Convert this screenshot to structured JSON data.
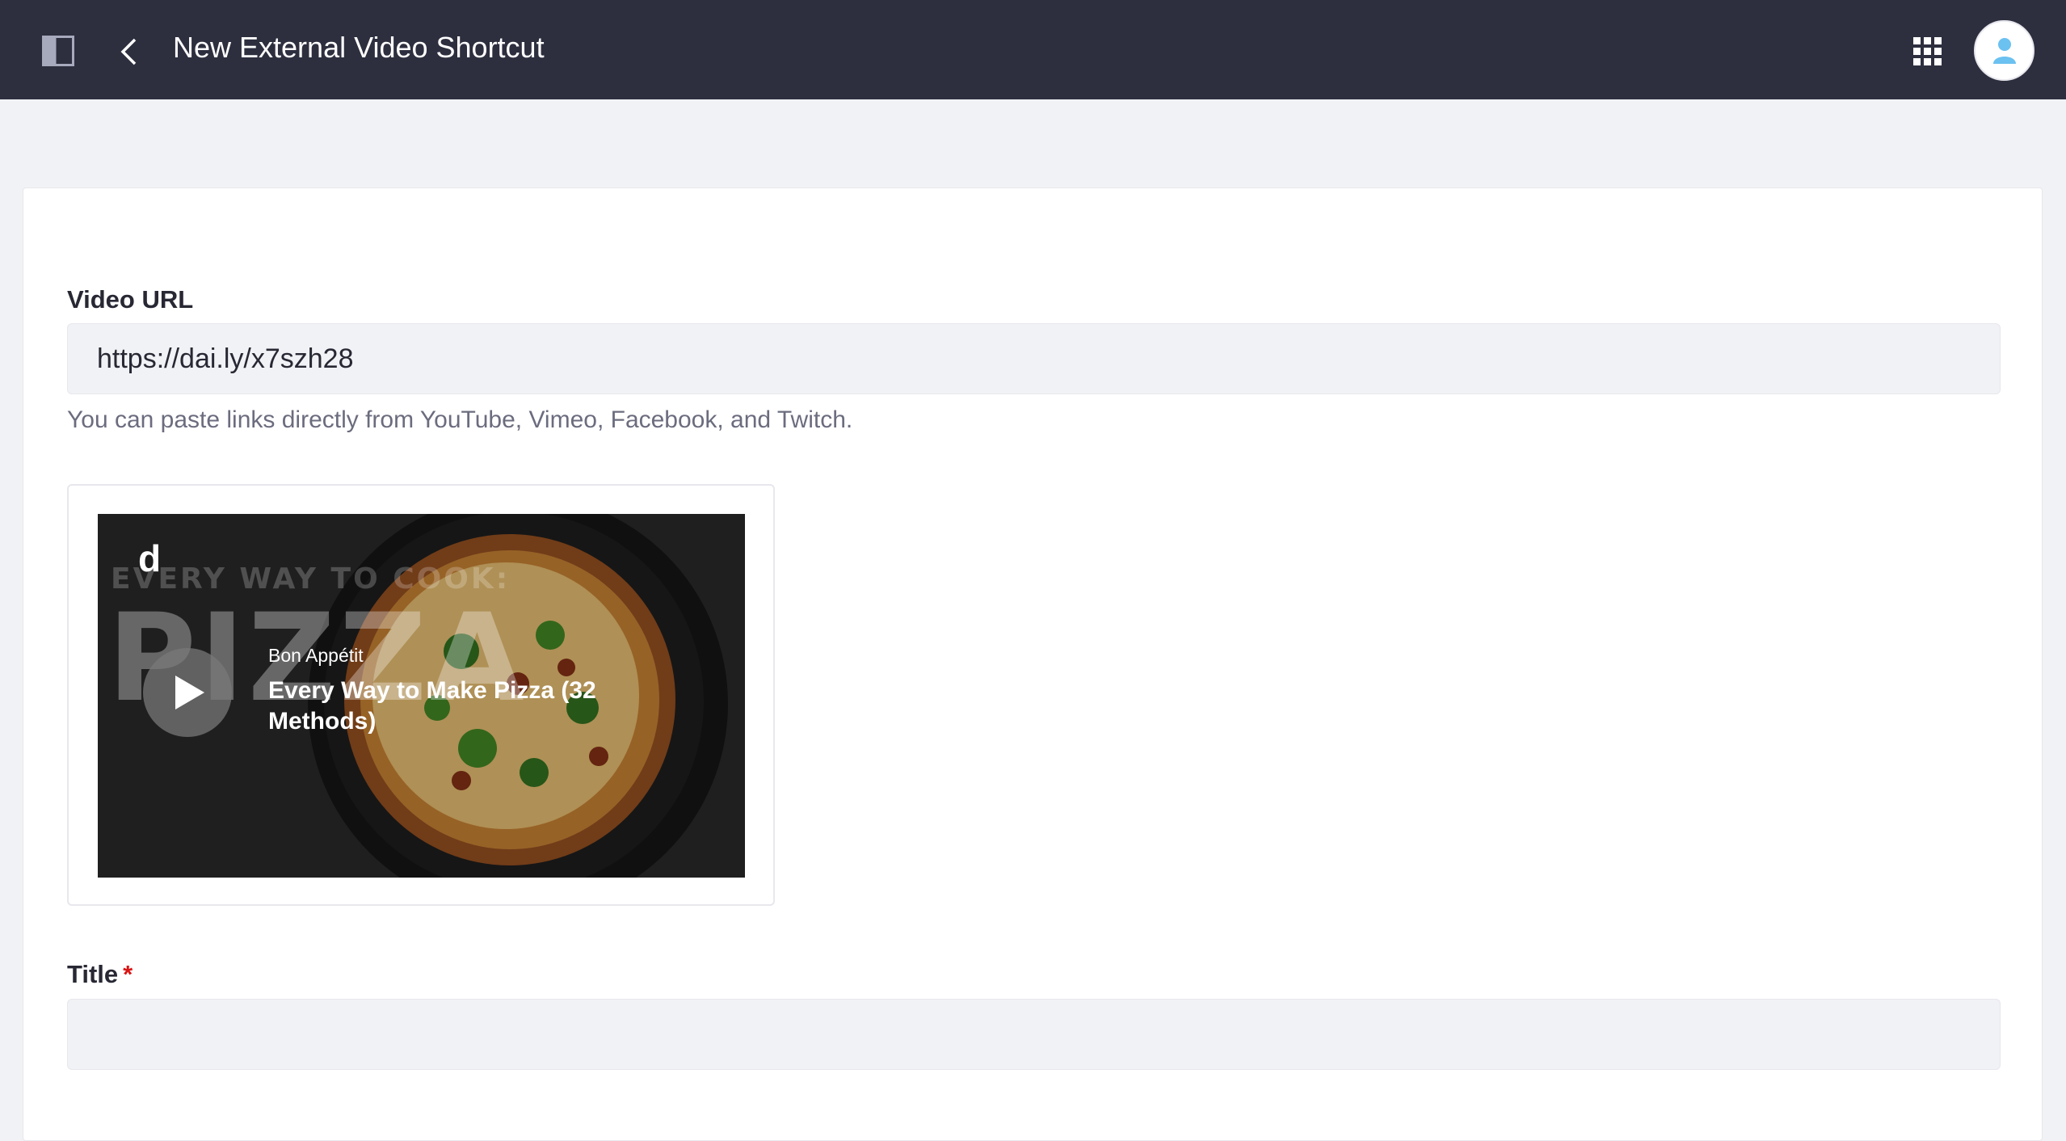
{
  "header": {
    "title": "New External Video Shortcut"
  },
  "form": {
    "video_url_label": "Video URL",
    "video_url_value": "https://dai.ly/x7szh28",
    "help_text": "You can paste links directly from YouTube, Vimeo, Facebook, and Twitch.",
    "title_label": "Title",
    "title_required_marker": "*",
    "title_value": ""
  },
  "preview": {
    "provider_logo": "d",
    "overlay_line_1": "EVERY WAY TO COOK:",
    "overlay_line_2": "PIZZA",
    "channel": "Bon Appétit",
    "video_title": "Every Way to Make Pizza (32 Methods)"
  },
  "colors": {
    "topbar": "#2d2f3f",
    "page_bg": "#f1f2f5",
    "required": "#da1414",
    "avatar_icon": "#6bc1f0"
  }
}
